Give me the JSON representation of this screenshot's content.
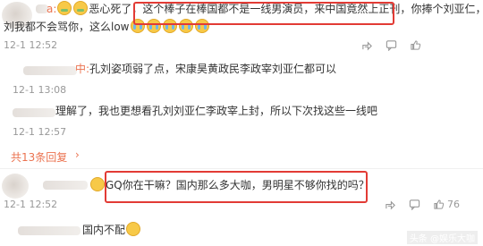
{
  "comments": [
    {
      "name": "a:",
      "text_a": "恶心死了，",
      "text_highlight": "这个棒子在棒国都不是一线男演员，来中国竟然上正刊，",
      "text_b": "你捧个刘亚仁，孔",
      "line2": "刘我都不会骂你，这么low",
      "time": "12-1 12:52"
    },
    {
      "name": "中:",
      "text": "孔刘姿项弱了点，宋康昊黄政民李政宰刘亚仁都可以",
      "time": "12-1 13:08"
    },
    {
      "text": "理解了，我也更想看孔刘刘亚仁李政宰上封，所以下次找这些一线吧",
      "time": "12-1 12:57"
    },
    {
      "text_highlight": "GQ你在干嘛？国内那么多大咖，男明星不够你找的吗？",
      "time": "12-1 12:52",
      "likes": "76"
    },
    {
      "text": "国内不配"
    }
  ],
  "reply_more": "共13条回复",
  "actions": {
    "share_icon": "share-icon",
    "comment_icon": "comment-icon",
    "like_icon": "like-icon"
  },
  "watermark": "头条 @娱乐大咖",
  "colors": {
    "highlight": "#e23b35",
    "username": "#eb7350",
    "timestamp": "#999999"
  }
}
